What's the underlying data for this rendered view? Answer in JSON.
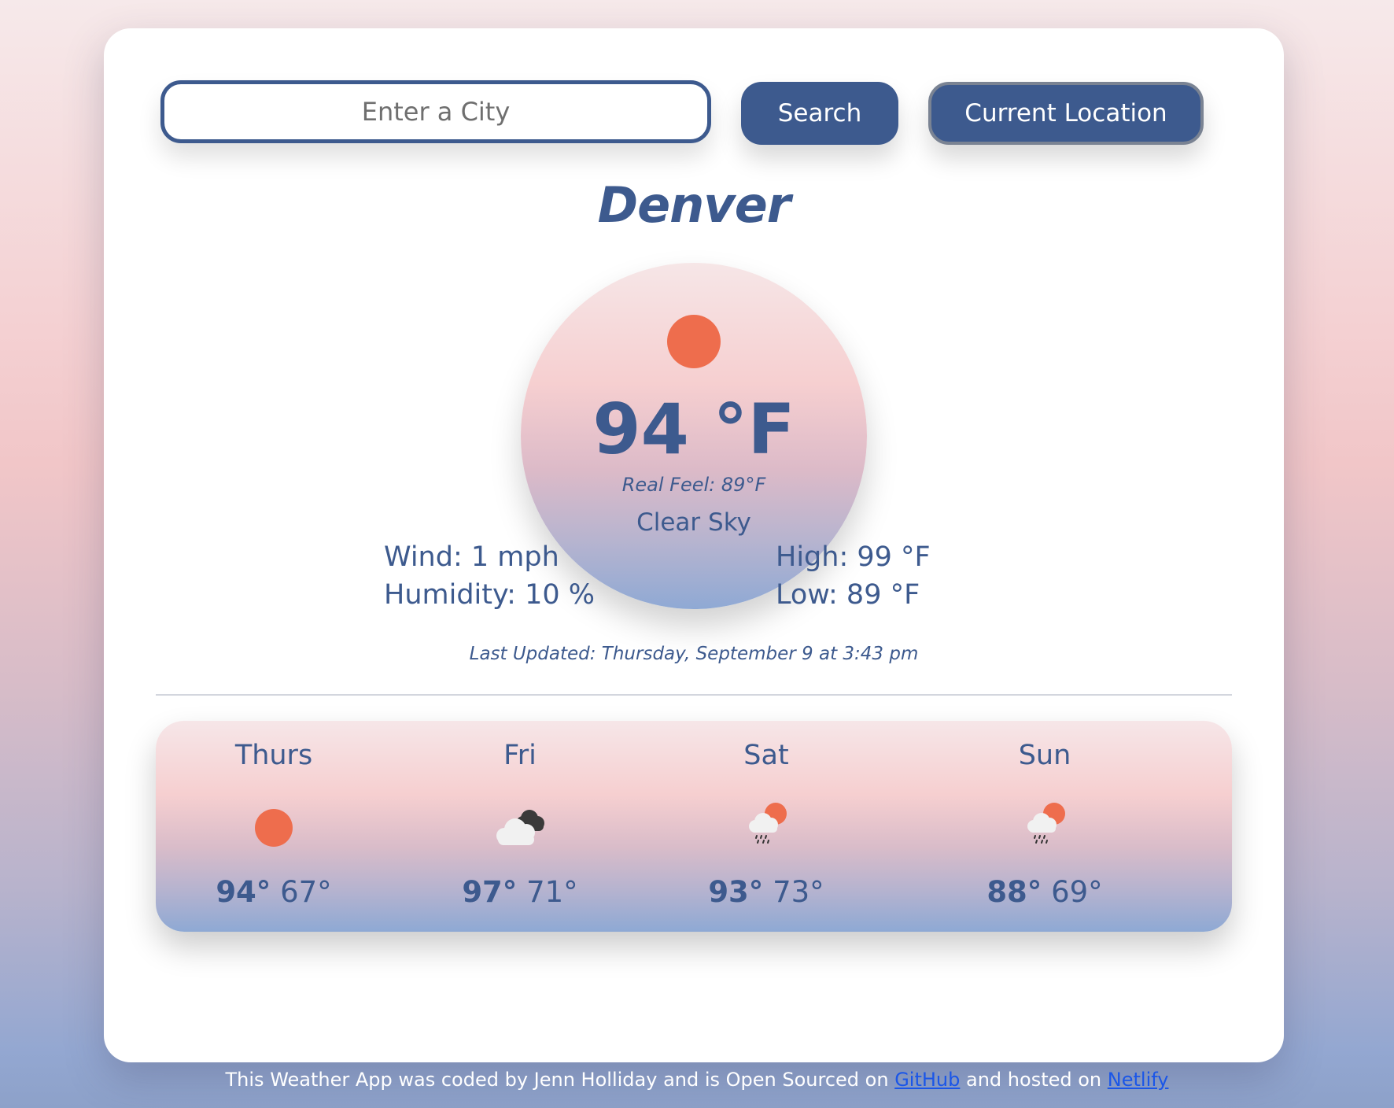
{
  "search": {
    "placeholder": "Enter a City",
    "search_label": "Search",
    "location_label": "Current Location"
  },
  "current": {
    "city": "Denver",
    "temperature": "94 °F",
    "real_feel": "Real Feel: 89°F",
    "description": "Clear Sky",
    "icon": "sun-icon",
    "wind": "Wind: 1 mph",
    "humidity": "Humidity: 10 %",
    "high": "High: 99 °F",
    "low": "Low: 89 °F",
    "last_updated": "Last Updated: Thursday, September 9 at 3:43 pm"
  },
  "forecast": [
    {
      "day": "Thurs",
      "icon": "sun-icon",
      "high": "94°",
      "low": "67°"
    },
    {
      "day": "Fri",
      "icon": "cloudy-icon",
      "high": "97°",
      "low": "71°"
    },
    {
      "day": "Sat",
      "icon": "rain-sun-icon",
      "high": "93°",
      "low": "73°"
    },
    {
      "day": "Sun",
      "icon": "rain-sun-icon",
      "high": "88°",
      "low": "69°"
    }
  ],
  "footer": {
    "text_1": "This Weather App was coded by Jenn Holliday and is Open Sourced on",
    "github_label": "GitHub",
    "text_2": "and hosted on",
    "netlify_label": "Netlify"
  },
  "colors": {
    "accent": "#3d5a8e",
    "sun": "#ee6d4d",
    "link": "#1a56e8"
  }
}
